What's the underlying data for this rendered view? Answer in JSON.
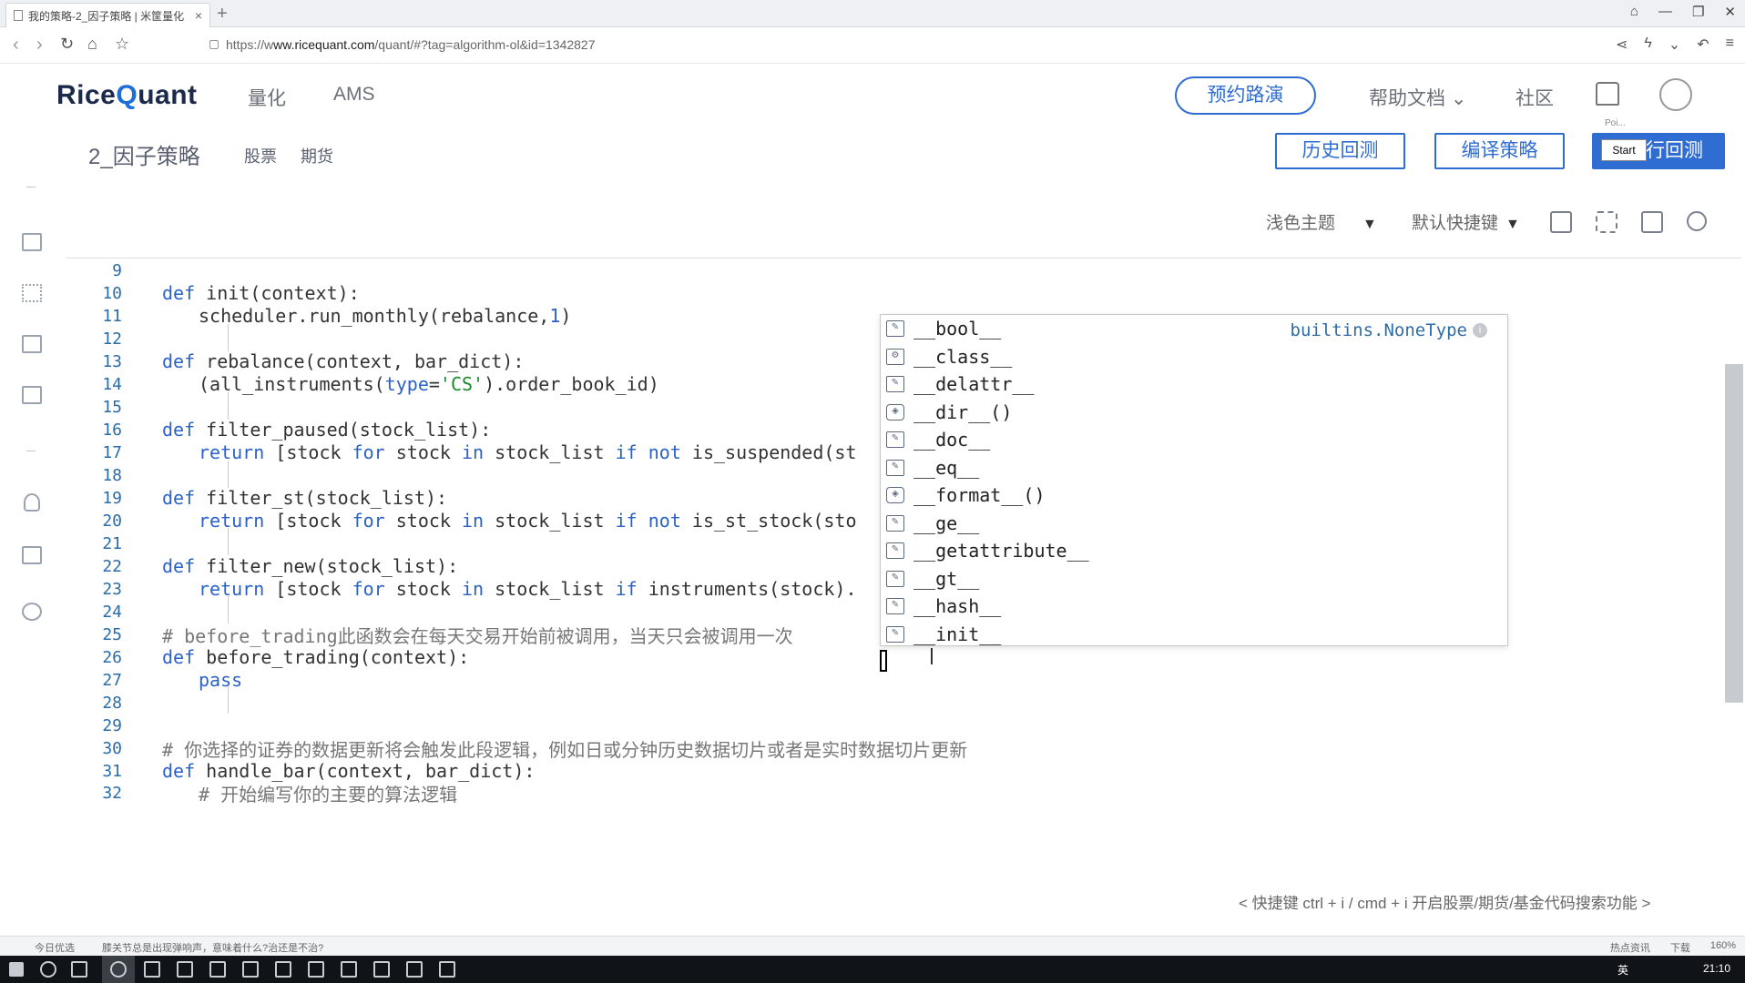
{
  "browser": {
    "tab_title": "我的策略-2_因子策略 | 米筐量化",
    "tab_close": "×",
    "new_tab": "+",
    "url_prefix": "https://w",
    "url_host": "ww.ricequant.com",
    "url_path": "/quant/#?tag=algorithm-ol&id=1342827"
  },
  "header": {
    "logo_left": "Rice",
    "logo_q": "Q",
    "logo_right": "uant",
    "nav": [
      "量化",
      "AMS"
    ],
    "demo_button": "预约路演",
    "help": "帮助文档 ⌄",
    "community": "社区"
  },
  "strategy": {
    "title": "2_因子策略",
    "tabs": [
      "股票",
      "期货"
    ],
    "history_backtest": "历史回测",
    "compile": "编译策略",
    "run_backtest": "行回测",
    "start_popup": "Start",
    "poi_label": "Poi..."
  },
  "toolbar": {
    "theme": "浅色主题",
    "keys": "默认快捷键",
    "arrow": "▼"
  },
  "editor": {
    "lines": [
      {
        "n": "9"
      },
      {
        "n": "10"
      },
      {
        "n": "11"
      },
      {
        "n": "12"
      },
      {
        "n": "13"
      },
      {
        "n": "14"
      },
      {
        "n": "15"
      },
      {
        "n": "16"
      },
      {
        "n": "17"
      },
      {
        "n": "18"
      },
      {
        "n": "19"
      },
      {
        "n": "20"
      },
      {
        "n": "21"
      },
      {
        "n": "22"
      },
      {
        "n": "23"
      },
      {
        "n": "24"
      },
      {
        "n": "25"
      },
      {
        "n": "26"
      },
      {
        "n": "27"
      },
      {
        "n": "28"
      },
      {
        "n": "29"
      },
      {
        "n": "30"
      },
      {
        "n": "31"
      },
      {
        "n": "32"
      }
    ],
    "code": {
      "l10_kw": "def",
      "l10": " init(context):",
      "l11": "scheduler.run_monthly(rebalance,",
      "l11_num": "1",
      "l11_end": ")",
      "l13_kw": "def",
      "l13": " rebalance(context, bar_dict):",
      "l14_a": "(all_instruments(",
      "l14_kw": "type",
      "l14_eq": "=",
      "l14_str": "'CS'",
      "l14_b": ").order_book_id)",
      "l16_kw": "def",
      "l16": " filter_paused(stock_list):",
      "l17_ret": "return",
      "l17_a": " [stock ",
      "l17_for": "for",
      "l17_b": " stock ",
      "l17_in": "in",
      "l17_c": " stock_list ",
      "l17_if": "if",
      "l17_d": " ",
      "l17_not": "not",
      "l17_e": " is_suspended(st",
      "l19_kw": "def",
      "l19": " filter_st(stock_list):",
      "l20_ret": "return",
      "l20_a": " [stock ",
      "l20_for": "for",
      "l20_b": " stock ",
      "l20_in": "in",
      "l20_c": " stock_list ",
      "l20_if": "if",
      "l20_d": " ",
      "l20_not": "not",
      "l20_e": " is_st_stock(sto",
      "l22_kw": "def",
      "l22": " filter_new(stock_list):",
      "l23_ret": "return",
      "l23_a": " [stock ",
      "l23_for": "for",
      "l23_b": " stock ",
      "l23_in": "in",
      "l23_c": " stock_list ",
      "l23_if": "if",
      "l23_e": " instruments(stock).",
      "l25": "# before_trading此函数会在每天交易开始前被调用，当天只会被调用一次",
      "l26_kw": "def",
      "l26": " before_trading(context):",
      "l27": "pass",
      "l30": "# 你选择的证券的数据更新将会触发此段逻辑，例如日或分钟历史数据切片或者是实时数据切片更新",
      "l31_kw": "def",
      "l31": " handle_bar(context, bar_dict):",
      "l32": "# 开始编写你的主要的算法逻辑"
    }
  },
  "autocomplete": {
    "type_hint": "builtins.NoneType",
    "items": [
      "__bool__",
      "__class__",
      "__delattr__",
      "__dir__()",
      "__doc__",
      "__eq__",
      "__format__()",
      "__ge__",
      "__getattribute__",
      "__gt__",
      "__hash__",
      "__init__"
    ]
  },
  "hint": "< 快捷键 ctrl + i / cmd + i 开启股票/期货/基金代码搜索功能 >",
  "statusbar": {
    "left": "今日优选",
    "news": "膝关节总是出现弹响声，意味着什么?治还是不治?",
    "right": [
      "热点资讯",
      "下载",
      "160%"
    ]
  },
  "taskbar": {
    "lang": "英",
    "clock": "21:10"
  }
}
